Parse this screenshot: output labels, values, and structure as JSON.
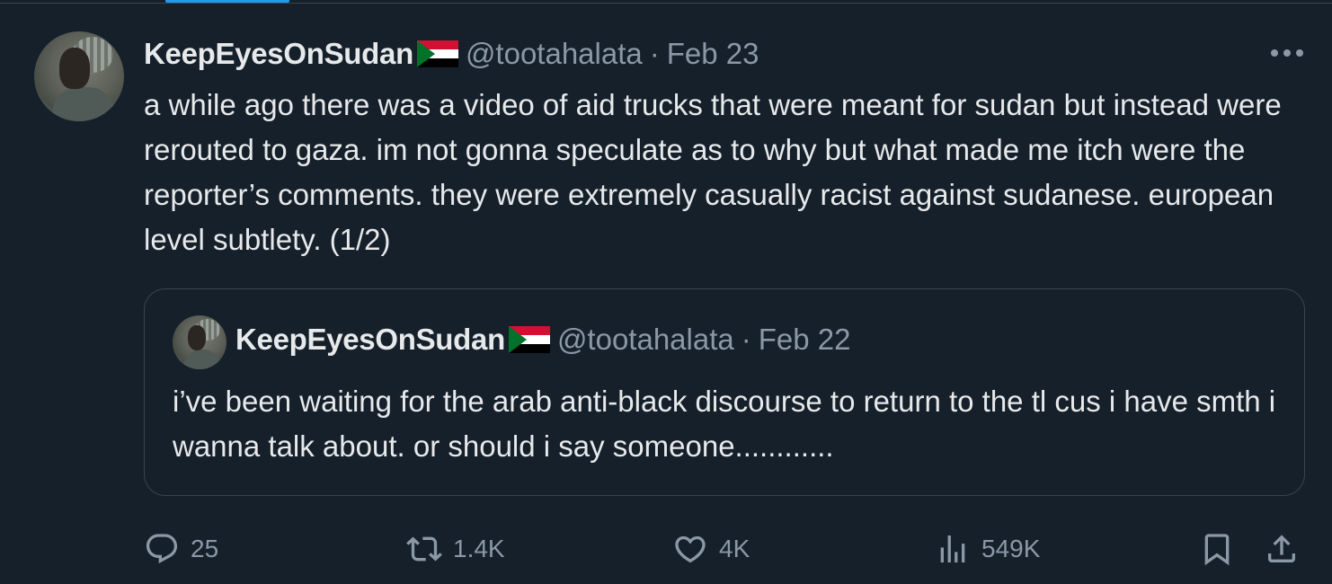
{
  "tweet": {
    "author_name": "KeepEyesOnSudan",
    "flag_icon": "sudan-flag",
    "handle": "@tootahalata",
    "separator": "·",
    "date": "Feb 23",
    "text": "a while ago there was a video of aid trucks that were meant for sudan but instead were rerouted to gaza. im not gonna speculate as to why but what made me itch were the reporter’s comments. they were extremely casually racist against sudanese. european level subtlety. (1/2)",
    "more_icon": "more-horizontal-icon"
  },
  "quoted_tweet": {
    "author_name": "KeepEyesOnSudan",
    "handle": "@tootahalata",
    "separator": "·",
    "date": "Feb 22",
    "text": "i’ve been waiting for the arab anti-black discourse to return to the tl cus i have smth i wanna talk about. or should i say someone............"
  },
  "actions": {
    "replies": "25",
    "retweets": "1.4K",
    "likes": "4K",
    "views": "549K"
  },
  "colors": {
    "background": "#15202b",
    "text": "#e7e9ea",
    "secondary": "#8b98a5",
    "border": "#38444d",
    "accent": "#1d9bf0"
  }
}
